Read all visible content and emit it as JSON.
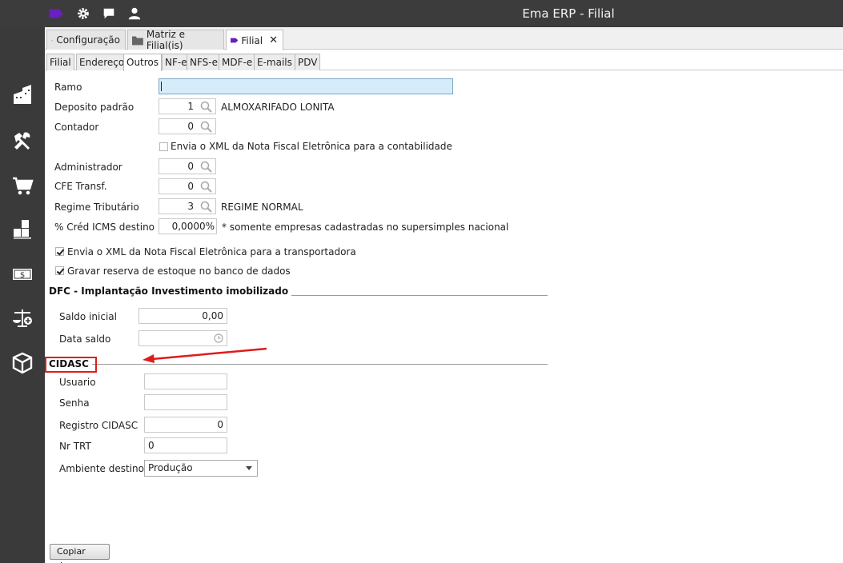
{
  "window": {
    "title": "Ema ERP - Filial"
  },
  "topbar_icons": [
    "tag-icon",
    "gear-icon",
    "chat-icon",
    "user-icon"
  ],
  "rail_icons": [
    "building-icon",
    "tools-icon",
    "cart-icon",
    "boxes-icon",
    "money-icon",
    "scales-icon",
    "package-icon"
  ],
  "window_tabs": [
    {
      "label": "Configuração",
      "icon": "gear-icon",
      "active": false
    },
    {
      "label": "Matriz e Filial(is)",
      "icon": "folder-icon",
      "active": false
    },
    {
      "label": "Filial",
      "icon": "tag-icon",
      "active": true,
      "close": "✕"
    }
  ],
  "sub_tabs": [
    {
      "label": "Filial"
    },
    {
      "label": "Endereço"
    },
    {
      "label": "Outros",
      "active": true
    },
    {
      "label": "NF-e"
    },
    {
      "label": "NFS-e"
    },
    {
      "label": "MDF-e"
    },
    {
      "label": "E-mails"
    },
    {
      "label": "PDV"
    }
  ],
  "form": {
    "ramo": {
      "label": "Ramo",
      "value": ""
    },
    "deposito": {
      "label": "Deposito padrão",
      "value": "1",
      "description": "ALMOXARIFADO LONITA"
    },
    "contador": {
      "label": "Contador",
      "value": "0"
    },
    "envia_xml_contabilidade": {
      "label": "Envia o XML da Nota Fiscal Eletrônica para a contabilidade",
      "checked": false
    },
    "administrador": {
      "label": "Administrador",
      "value": "0"
    },
    "cfe_transf": {
      "label": "CFE Transf.",
      "value": "0"
    },
    "regime": {
      "label": "Regime Tributário",
      "value": "3",
      "description": "REGIME NORMAL"
    },
    "cred_icms": {
      "label": "% Créd ICMS destino",
      "value": "0,0000%",
      "note": "* somente empresas cadastradas no supersimples nacional"
    },
    "envia_xml_transportadora": {
      "label": "Envia o XML da Nota Fiscal Eletrônica para a transportadora",
      "checked": true
    },
    "gravar_reserva": {
      "label": "Gravar reserva de estoque no banco de dados",
      "checked": true
    }
  },
  "dfc": {
    "title": "DFC - Implantação Investimento imobilizado",
    "saldo_inicial": {
      "label": "Saldo inicial",
      "value": "0,00"
    },
    "data_saldo": {
      "label": "Data saldo",
      "value": ""
    }
  },
  "cidasc": {
    "title": "CIDASC",
    "usuario": {
      "label": "Usuario",
      "value": ""
    },
    "senha": {
      "label": "Senha",
      "value": ""
    },
    "registro": {
      "label": "Registro CIDASC",
      "value": "0"
    },
    "nr_trt": {
      "label": "Nr TRT",
      "value": "0"
    },
    "ambiente": {
      "label": "Ambiente destino",
      "value": "Produção"
    }
  },
  "footer": {
    "copy_button": "Copiar de..."
  },
  "colors": {
    "accent_purple": "#6a1fc1",
    "callout_red": "#e01b1b",
    "field_highlight": "#d6ecfa"
  }
}
